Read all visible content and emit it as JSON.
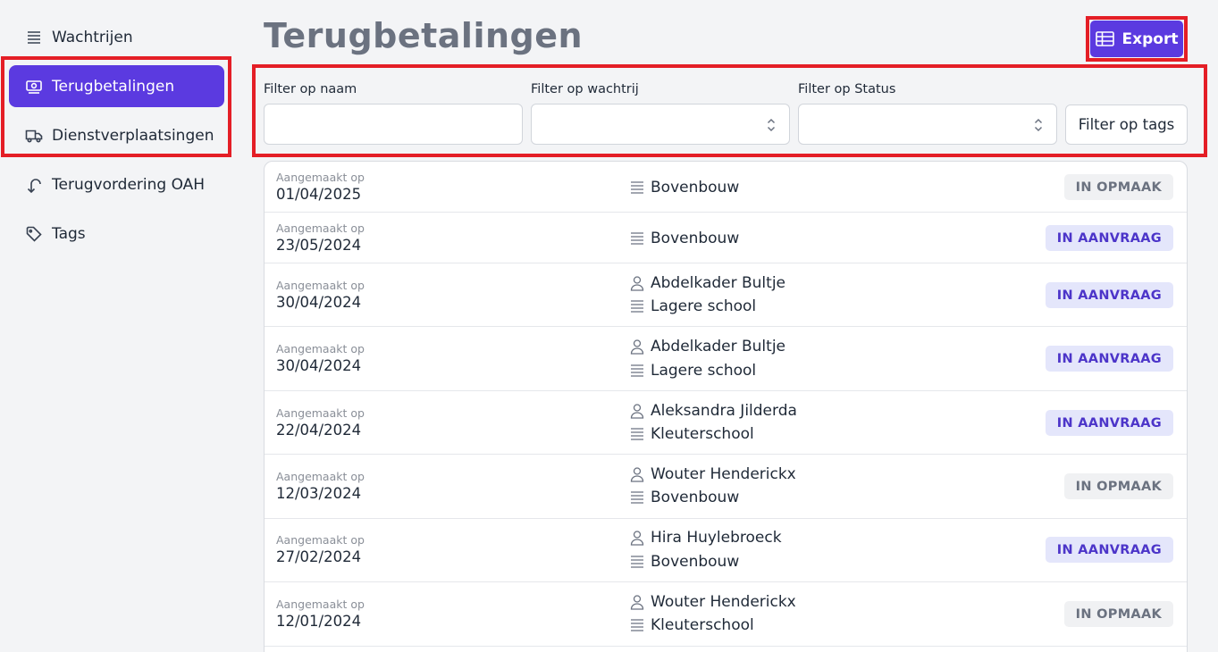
{
  "sidebar": {
    "items": [
      {
        "label": "Wachtrijen",
        "icon": "queue-icon"
      },
      {
        "label": "Terugbetalingen",
        "icon": "money-icon"
      },
      {
        "label": "Dienstverplaatsingen",
        "icon": "truck-icon"
      },
      {
        "label": "Terugvordering OAH",
        "icon": "return-arrow-icon"
      },
      {
        "label": "Tags",
        "icon": "tag-icon"
      }
    ],
    "active_index": 1
  },
  "header": {
    "title": "Terugbetalingen",
    "export_label": "Export"
  },
  "filters": {
    "name_label": "Filter op naam",
    "name_value": "",
    "queue_label": "Filter op wachtrij",
    "queue_value": "",
    "status_label": "Filter op Status",
    "status_value": "",
    "tags_button": "Filter op tags"
  },
  "colors": {
    "accent": "#5b3ae0",
    "highlight": "#e41e26",
    "badge_request_bg": "#e4e6fb",
    "badge_request_text": "#4c35c9",
    "badge_draft_bg": "#f0f1f3",
    "badge_draft_text": "#6b7280"
  },
  "list": {
    "created_label": "Aangemaakt op",
    "rows": [
      {
        "date": "01/04/2025",
        "person": "",
        "queue": "Bovenbouw",
        "status": "IN OPMAAK",
        "status_type": "draft"
      },
      {
        "date": "23/05/2024",
        "person": "",
        "queue": "Bovenbouw",
        "status": "IN AANVRAAG",
        "status_type": "request"
      },
      {
        "date": "30/04/2024",
        "person": "Abdelkader Bultje",
        "queue": "Lagere school",
        "status": "IN AANVRAAG",
        "status_type": "request"
      },
      {
        "date": "30/04/2024",
        "person": "Abdelkader Bultje",
        "queue": "Lagere school",
        "status": "IN AANVRAAG",
        "status_type": "request"
      },
      {
        "date": "22/04/2024",
        "person": "Aleksandra Jilderda",
        "queue": "Kleuterschool",
        "status": "IN AANVRAAG",
        "status_type": "request"
      },
      {
        "date": "12/03/2024",
        "person": "Wouter Henderickx",
        "queue": "Bovenbouw",
        "status": "IN OPMAAK",
        "status_type": "draft"
      },
      {
        "date": "27/02/2024",
        "person": "Hira Huylebroeck",
        "queue": "Bovenbouw",
        "status": "IN AANVRAAG",
        "status_type": "request"
      },
      {
        "date": "12/01/2024",
        "person": "Wouter Henderickx",
        "queue": "Kleuterschool",
        "status": "IN OPMAAK",
        "status_type": "draft"
      }
    ]
  }
}
